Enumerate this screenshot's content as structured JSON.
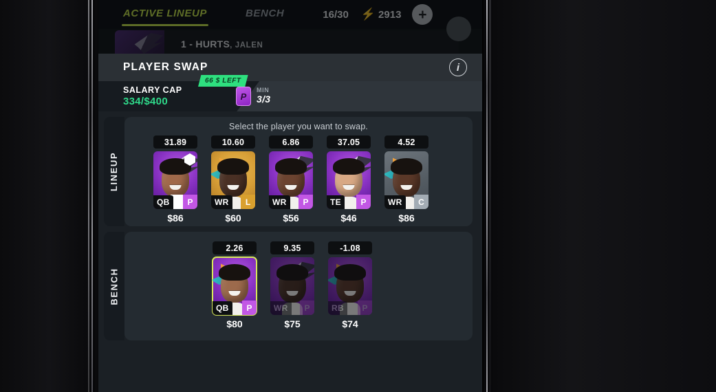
{
  "topbar": {
    "tab_active": "ACTIVE LINEUP",
    "tab_inactive": "BENCH",
    "roster_count": "16/30",
    "bolt_icon": "bolt-icon",
    "coins": "2913",
    "add_label": "+"
  },
  "roster_row": {
    "number": "1 - HURTS",
    "first_name": ", JALEN"
  },
  "modal": {
    "title": "PLAYER SWAP",
    "info_icon": "info-icon",
    "salary_cap_label": "SALARY CAP",
    "salary_cap_value": "334/$400",
    "left_pill": "66 $ LEFT",
    "min_label": "MIN",
    "min_value": "3/3",
    "min_chip_icon": "premium-card-icon",
    "hint": "Select the player you want to swap."
  },
  "sections": {
    "lineup_label": "LINEUP",
    "bench_label": "BENCH"
  },
  "lineup_cards": [
    {
      "score": "31.89",
      "pos": "QB",
      "tier": "P",
      "price": "$86",
      "bg": "bg-purple",
      "skin": "skin-1",
      "badge": true,
      "art": "wing",
      "dim": false,
      "selected": false,
      "slot": true
    },
    {
      "score": "10.60",
      "pos": "WR",
      "tier": "L",
      "price": "$60",
      "bg": "bg-gold",
      "skin": "skin-2",
      "badge": false,
      "art": "spikes",
      "dim": false,
      "selected": false,
      "slot": false
    },
    {
      "score": "6.86",
      "pos": "WR",
      "tier": "P",
      "price": "$56",
      "bg": "bg-purple",
      "skin": "skin-3",
      "badge": false,
      "art": "wing",
      "dim": false,
      "selected": false,
      "slot": false
    },
    {
      "score": "37.05",
      "pos": "TE",
      "tier": "P",
      "price": "$46",
      "bg": "bg-purple",
      "skin": "skin-4",
      "badge": false,
      "art": "wing",
      "dim": false,
      "selected": false,
      "slot": false
    },
    {
      "score": "4.52",
      "pos": "WR",
      "tier": "C",
      "price": "$86",
      "bg": "bg-grey",
      "skin": "skin-5",
      "badge": false,
      "art": "spikes",
      "dim": false,
      "selected": false,
      "slot": false
    }
  ],
  "bench_cards": [
    {
      "score": "2.26",
      "pos": "QB",
      "tier": "P",
      "price": "$80",
      "bg": "bg-purple",
      "skin": "skin-6",
      "badge": false,
      "art": "spikes",
      "dim": false,
      "selected": true,
      "slot": false
    },
    {
      "score": "9.35",
      "pos": "WR",
      "tier": "P",
      "price": "$75",
      "bg": "bg-purple",
      "skin": "skin-2",
      "badge": false,
      "art": "wing",
      "dim": true,
      "selected": false,
      "slot": false
    },
    {
      "score": "-1.08",
      "pos": "RB",
      "tier": "P",
      "price": "$74",
      "bg": "bg-purple",
      "skin": "skin-5",
      "badge": false,
      "art": "spikes",
      "dim": true,
      "selected": false,
      "slot": false
    }
  ],
  "colors": {
    "accent_green": "#c8e64a",
    "money_green": "#2fd98a",
    "pill_green": "#2ee07f",
    "tier_purple": "#c257e5",
    "tier_gold": "#d9a02e",
    "tier_common": "#a3acb4",
    "selected_border": "#d7e95a"
  }
}
